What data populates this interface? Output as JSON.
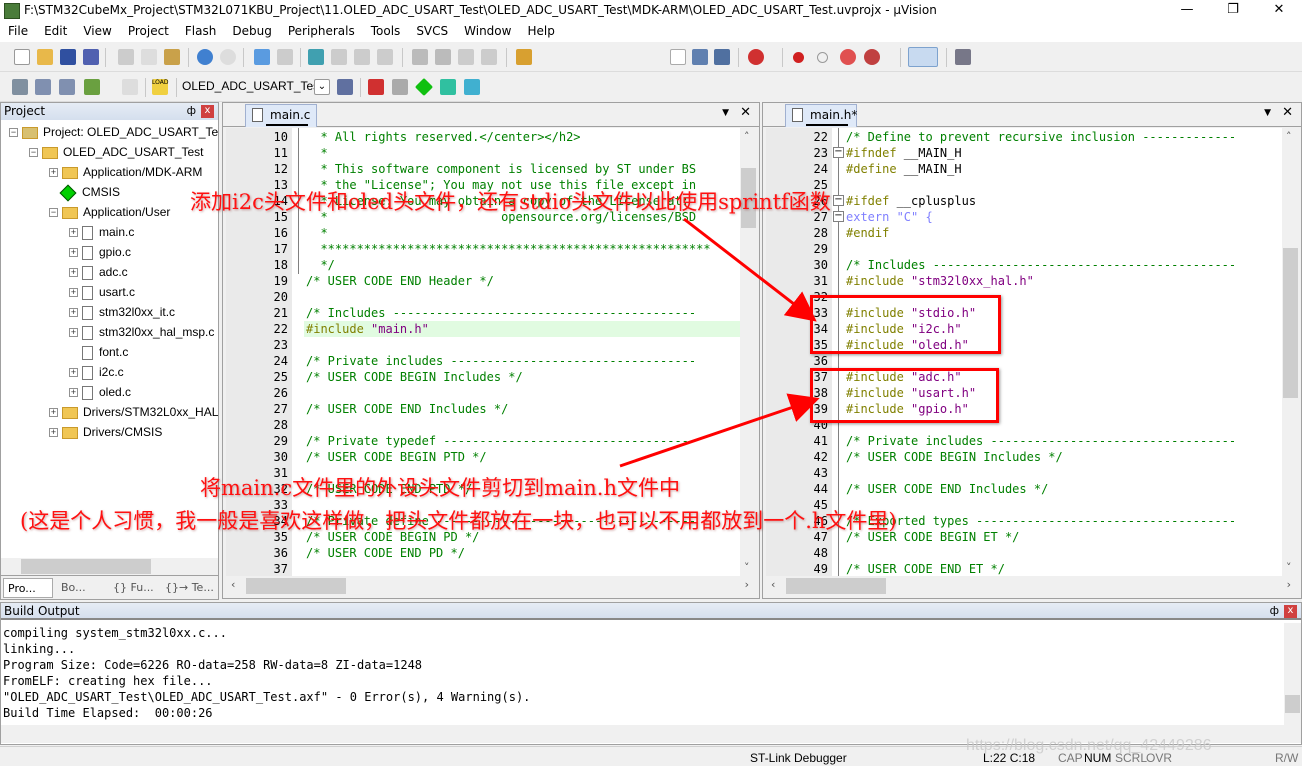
{
  "window": {
    "title": "F:\\STM32CubeMx_Project\\STM32L071KBU_Project\\11.OLED_ADC_USART_Test\\OLED_ADC_USART_Test\\MDK-ARM\\OLED_ADC_USART_Test.uvprojx - µVision",
    "minimize": "—",
    "maximize": "❐",
    "close": "✕"
  },
  "menu": [
    "File",
    "Edit",
    "View",
    "Project",
    "Flash",
    "Debug",
    "Peripherals",
    "Tools",
    "SVCS",
    "Window",
    "Help"
  ],
  "toolbar2": {
    "target_select": "OLED_ADC_USART_Test",
    "load_label": "LOAD"
  },
  "project_panel": {
    "title": "Project",
    "pin": "ф",
    "close": "x",
    "tree": [
      {
        "label": "Project: OLED_ADC_USART_Test",
        "level": 0,
        "expander": "−",
        "icon": "project"
      },
      {
        "label": "OLED_ADC_USART_Test",
        "level": 1,
        "expander": "−",
        "icon": "target"
      },
      {
        "label": "Application/MDK-ARM",
        "level": 2,
        "expander": "+",
        "icon": "folder"
      },
      {
        "label": "CMSIS",
        "level": 2,
        "expander": "",
        "icon": "cmsis"
      },
      {
        "label": "Application/User",
        "level": 2,
        "expander": "−",
        "icon": "folder-open"
      },
      {
        "label": "main.c",
        "level": 3,
        "expander": "+",
        "icon": "file"
      },
      {
        "label": "gpio.c",
        "level": 3,
        "expander": "+",
        "icon": "file"
      },
      {
        "label": "adc.c",
        "level": 3,
        "expander": "+",
        "icon": "file"
      },
      {
        "label": "usart.c",
        "level": 3,
        "expander": "+",
        "icon": "file"
      },
      {
        "label": "stm32l0xx_it.c",
        "level": 3,
        "expander": "+",
        "icon": "file"
      },
      {
        "label": "stm32l0xx_hal_msp.c",
        "level": 3,
        "expander": "+",
        "icon": "file"
      },
      {
        "label": "font.c",
        "level": 3,
        "expander": "",
        "icon": "file"
      },
      {
        "label": "i2c.c",
        "level": 3,
        "expander": "+",
        "icon": "file"
      },
      {
        "label": "oled.c",
        "level": 3,
        "expander": "+",
        "icon": "file"
      },
      {
        "label": "Drivers/STM32L0xx_HAL_",
        "level": 2,
        "expander": "+",
        "icon": "folder"
      },
      {
        "label": "Drivers/CMSIS",
        "level": 2,
        "expander": "+",
        "icon": "folder"
      }
    ],
    "tabs": [
      "Pro...",
      "Bo...",
      "{} Fu...",
      "{}→ Te..."
    ]
  },
  "editors": [
    {
      "tab": "main.c",
      "lines": [
        {
          "n": "10",
          "p": [
            [
              "cm",
              "  * All rights reserved.</center></h2>"
            ]
          ]
        },
        {
          "n": "11",
          "p": [
            [
              "cm",
              "  *"
            ]
          ]
        },
        {
          "n": "12",
          "p": [
            [
              "cm",
              "  * This software component is licensed by ST under BS"
            ]
          ]
        },
        {
          "n": "13",
          "p": [
            [
              "cm",
              "  * the \"License\"; You may not use this file except in"
            ]
          ]
        },
        {
          "n": "14",
          "p": [
            [
              "cm",
              "  * License. You may obtain a copy of the License at:"
            ]
          ]
        },
        {
          "n": "15",
          "p": [
            [
              "cm",
              "  *                        opensource.org/licenses/BSD"
            ]
          ]
        },
        {
          "n": "16",
          "p": [
            [
              "cm",
              "  *"
            ]
          ]
        },
        {
          "n": "17",
          "p": [
            [
              "cm",
              "  ******************************************************"
            ]
          ]
        },
        {
          "n": "18",
          "p": [
            [
              "cm",
              "  */"
            ]
          ]
        },
        {
          "n": "19",
          "p": [
            [
              "cm",
              "/* USER CODE END Header */"
            ]
          ]
        },
        {
          "n": "20",
          "p": []
        },
        {
          "n": "21",
          "p": [
            [
              "cm",
              "/* Includes ------------------------------------------"
            ]
          ]
        },
        {
          "n": "22",
          "p": [
            [
              "pp",
              "#include "
            ],
            [
              "st",
              "\"main.h\""
            ]
          ],
          "hl": true
        },
        {
          "n": "23",
          "p": []
        },
        {
          "n": "24",
          "p": [
            [
              "cm",
              "/* Private includes ----------------------------------"
            ]
          ]
        },
        {
          "n": "25",
          "p": [
            [
              "cm",
              "/* USER CODE BEGIN Includes */"
            ]
          ]
        },
        {
          "n": "26",
          "p": []
        },
        {
          "n": "27",
          "p": [
            [
              "cm",
              "/* USER CODE END Includes */"
            ]
          ]
        },
        {
          "n": "28",
          "p": []
        },
        {
          "n": "29",
          "p": [
            [
              "cm",
              "/* Private typedef -----------------------------------"
            ]
          ]
        },
        {
          "n": "30",
          "p": [
            [
              "cm",
              "/* USER CODE BEGIN PTD */"
            ]
          ]
        },
        {
          "n": "31",
          "p": []
        },
        {
          "n": "32",
          "p": [
            [
              "cm",
              "/* USER CODE END PTD */"
            ]
          ]
        },
        {
          "n": "33",
          "p": []
        },
        {
          "n": "34",
          "p": [
            [
              "cm",
              "/* Private define ------------------------------------"
            ]
          ]
        },
        {
          "n": "35",
          "p": [
            [
              "cm",
              "/* USER CODE BEGIN PD */"
            ]
          ]
        },
        {
          "n": "36",
          "p": [
            [
              "cm",
              "/* USER CODE END PD */"
            ]
          ]
        },
        {
          "n": "37",
          "p": []
        }
      ]
    },
    {
      "tab": "main.h*",
      "lines": [
        {
          "n": "22",
          "p": [
            [
              "cm",
              "/* Define to prevent recursive inclusion -------------"
            ]
          ]
        },
        {
          "n": "23",
          "p": [
            [
              "pp",
              "#ifndef "
            ],
            [
              "tx",
              "__MAIN_H"
            ]
          ],
          "fold": "−"
        },
        {
          "n": "24",
          "p": [
            [
              "pp",
              "#define "
            ],
            [
              "tx",
              "__MAIN_H"
            ]
          ]
        },
        {
          "n": "25",
          "p": []
        },
        {
          "n": "26",
          "p": [
            [
              "pp",
              "#ifdef "
            ],
            [
              "tx",
              "__cplusplus"
            ]
          ],
          "fold": "−"
        },
        {
          "n": "27",
          "p": [
            [
              "kw",
              "extern \"C\" {"
            ]
          ],
          "fold": "−"
        },
        {
          "n": "28",
          "p": [
            [
              "pp",
              "#endif"
            ]
          ]
        },
        {
          "n": "29",
          "p": []
        },
        {
          "n": "30",
          "p": [
            [
              "cm",
              "/* Includes ------------------------------------------"
            ]
          ]
        },
        {
          "n": "31",
          "p": [
            [
              "pp",
              "#include "
            ],
            [
              "st",
              "\"stm32l0xx_hal.h\""
            ]
          ]
        },
        {
          "n": "32",
          "p": []
        },
        {
          "n": "33",
          "p": [
            [
              "pp",
              "#include "
            ],
            [
              "st",
              "\"stdio.h\""
            ]
          ]
        },
        {
          "n": "34",
          "p": [
            [
              "pp",
              "#include "
            ],
            [
              "st",
              "\"i2c.h\""
            ]
          ]
        },
        {
          "n": "35",
          "p": [
            [
              "pp",
              "#include "
            ],
            [
              "st",
              "\"oled.h\""
            ]
          ]
        },
        {
          "n": "36",
          "p": []
        },
        {
          "n": "37",
          "p": [
            [
              "pp",
              "#include "
            ],
            [
              "st",
              "\"adc.h\""
            ]
          ]
        },
        {
          "n": "38",
          "p": [
            [
              "pp",
              "#include "
            ],
            [
              "st",
              "\"usart.h\""
            ]
          ]
        },
        {
          "n": "39",
          "p": [
            [
              "pp",
              "#include "
            ],
            [
              "st",
              "\"gpio.h\""
            ]
          ]
        },
        {
          "n": "40",
          "p": []
        },
        {
          "n": "41",
          "p": [
            [
              "cm",
              "/* Private includes ----------------------------------"
            ]
          ]
        },
        {
          "n": "42",
          "p": [
            [
              "cm",
              "/* USER CODE BEGIN Includes */"
            ]
          ]
        },
        {
          "n": "43",
          "p": []
        },
        {
          "n": "44",
          "p": [
            [
              "cm",
              "/* USER CODE END Includes */"
            ]
          ]
        },
        {
          "n": "45",
          "p": []
        },
        {
          "n": "46",
          "p": [
            [
              "cm",
              "/* Exported types ------------------------------------"
            ]
          ]
        },
        {
          "n": "47",
          "p": [
            [
              "cm",
              "/* USER CODE BEGIN ET */"
            ]
          ]
        },
        {
          "n": "48",
          "p": []
        },
        {
          "n": "49",
          "p": [
            [
              "cm",
              "/* USER CODE END ET */"
            ]
          ]
        }
      ]
    }
  ],
  "build_output": {
    "title": "Build Output",
    "lines": [
      "compiling system_stm32l0xx.c...",
      "linking...",
      "Program Size: Code=6226 RO-data=258 RW-data=8 ZI-data=1248",
      "FromELF: creating hex file...",
      "\"OLED_ADC_USART_Test\\OLED_ADC_USART_Test.axf\" - 0 Error(s), 4 Warning(s).",
      "Build Time Elapsed:  00:00:26"
    ]
  },
  "status": {
    "debugger": "ST-Link Debugger",
    "position": "L:22 C:18",
    "cap": "CAP",
    "num": "NUM",
    "scrl": "SCRL",
    "ovr": "OVR",
    "rw": "R/W"
  },
  "annotations": {
    "note1": "添加i2c头文件和oled头文件，还有stdio头文件以此使用sprintf函数",
    "note2": "将main.c文件里的外设头文件剪切到main.h文件中",
    "note3": "(这是个人习惯，我一般是喜欢这样做，把头文件都放在一块，也可以不用都放到一个.h文件里)",
    "color": "#ff0000"
  },
  "watermark": "https://blog.csdn.net/qq_42449286"
}
